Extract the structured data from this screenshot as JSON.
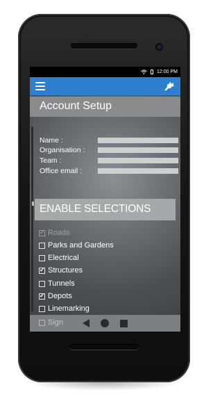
{
  "status": {
    "time": "12:00 PM"
  },
  "screen": {
    "title": "Account Setup"
  },
  "form": {
    "fields": [
      {
        "label": "Name :",
        "value": ""
      },
      {
        "label": "Organisation :",
        "value": ""
      },
      {
        "label": "Team :",
        "value": ""
      },
      {
        "label": "Office email :",
        "value": ""
      }
    ]
  },
  "section": {
    "title": "ENABLE SELECTIONS"
  },
  "selections": [
    {
      "label": "Roads",
      "checked": true,
      "disabled": true
    },
    {
      "label": "Parks and Gardens",
      "checked": false
    },
    {
      "label": "Electrical",
      "checked": false
    },
    {
      "label": "Structures",
      "checked": true
    },
    {
      "label": "Tunnels",
      "checked": false
    },
    {
      "label": "Depots",
      "checked": true
    },
    {
      "label": "Linemarking",
      "checked": false
    },
    {
      "label": "Sign",
      "checked": false
    }
  ],
  "icons": {
    "menu": "hamburger-menu-icon",
    "settings": "wrench-icon",
    "wifi": "wifi-icon",
    "battery": "battery-icon",
    "back": "back-triangle-icon",
    "home": "home-circle-icon",
    "recent": "recent-square-icon"
  },
  "colors": {
    "appbar": "#2e7fd0",
    "title_bar": "#8a8b8d",
    "section_bar": "#a7a8aa"
  }
}
